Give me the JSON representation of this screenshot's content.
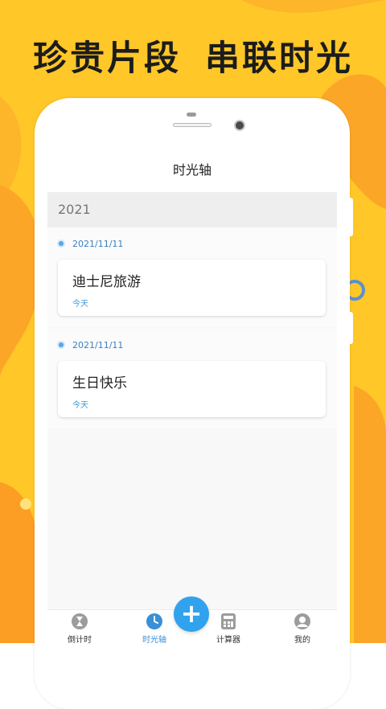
{
  "promo": {
    "headline_left": "珍贵片段",
    "headline_right": "串联时光"
  },
  "colors": {
    "background": "#ffc727",
    "blob_orange": "#fba626",
    "accent_blue": "#31a2ee",
    "date_blue": "#3b7fc0"
  },
  "screen": {
    "title": "时光轴",
    "year": "2021",
    "entries": [
      {
        "date": "2021/11/11",
        "title": "迪士尼旅游",
        "tag": "今天"
      },
      {
        "date": "2021/11/11",
        "title": "生日快乐",
        "tag": "今天"
      }
    ]
  },
  "tabbar": {
    "tabs": [
      {
        "label": "倒计时",
        "icon": "hourglass-icon",
        "active": false
      },
      {
        "label": "时光轴",
        "icon": "clock-icon",
        "active": true
      },
      {
        "label": "计算器",
        "icon": "calculator-icon",
        "active": false
      },
      {
        "label": "我的",
        "icon": "profile-icon",
        "active": false
      }
    ],
    "add_icon": "plus-icon",
    "add_symbol": "+"
  }
}
